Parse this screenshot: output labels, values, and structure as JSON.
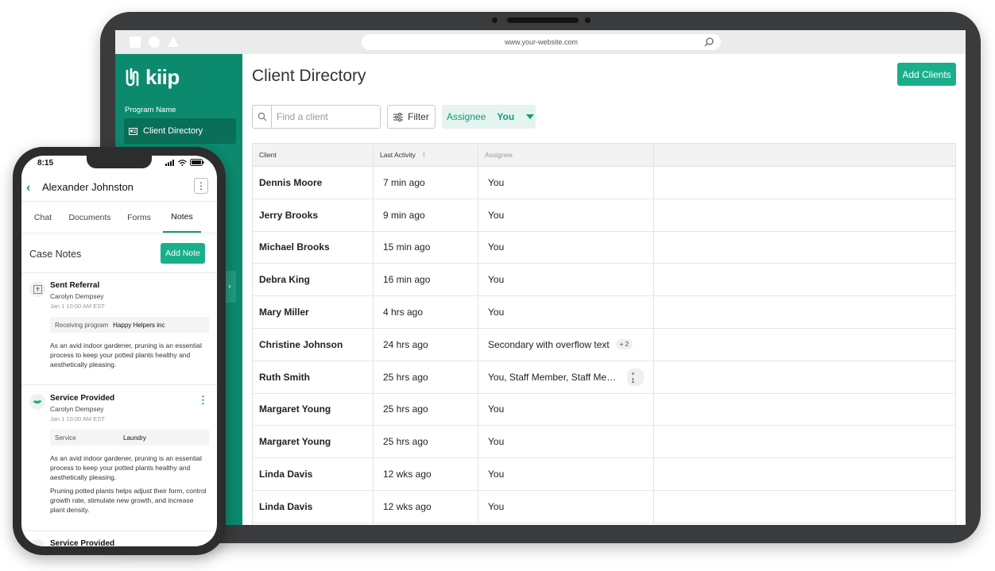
{
  "browser": {
    "url": "www.your-website.com"
  },
  "sidebar": {
    "logo_text": "kiip",
    "program_label": "Program Name",
    "items": [
      {
        "label": "Client Directory"
      }
    ]
  },
  "main": {
    "title": "Client Directory",
    "add_button": "Add Clients",
    "search_placeholder": "Find a client",
    "filter_label": "Filter",
    "assignee_label": "Assignee",
    "assignee_value": "You",
    "columns": {
      "client": "Client",
      "activity": "Last Activity",
      "assignee": "Assignee"
    },
    "rows": [
      {
        "client": "Dennis Moore",
        "activity": "7 min ago",
        "assignee": "You",
        "extra": ""
      },
      {
        "client": "Jerry Brooks",
        "activity": "9 min ago",
        "assignee": "You",
        "extra": ""
      },
      {
        "client": "Michael Brooks",
        "activity": "15 min ago",
        "assignee": "You",
        "extra": ""
      },
      {
        "client": "Debra King",
        "activity": "16 min ago",
        "assignee": "You",
        "extra": ""
      },
      {
        "client": "Mary Miller",
        "activity": "4 hrs ago",
        "assignee": "You",
        "extra": ""
      },
      {
        "client": "Christine Johnson",
        "activity": "24 hrs ago",
        "assignee": "Secondary with overflow text",
        "extra": "+ 2"
      },
      {
        "client": "Ruth Smith",
        "activity": "25 hrs ago",
        "assignee": "You, Staff Member, Staff Member",
        "extra": "+ 1"
      },
      {
        "client": "Margaret Young",
        "activity": "25 hrs ago",
        "assignee": "You",
        "extra": ""
      },
      {
        "client": "Margaret Young",
        "activity": "25 hrs ago",
        "assignee": "You",
        "extra": ""
      },
      {
        "client": "Linda Davis",
        "activity": "12 wks ago",
        "assignee": "You",
        "extra": ""
      },
      {
        "client": "Linda Davis",
        "activity": "12 wks ago",
        "assignee": "You",
        "extra": ""
      }
    ]
  },
  "phone": {
    "time": "8:15",
    "contact_name": "Alexander Johnston",
    "tabs": [
      "Chat",
      "Documents",
      "Forms",
      "Notes"
    ],
    "section_title": "Case Notes",
    "add_note": "Add Note",
    "notes": [
      {
        "icon": "referral-icon",
        "title": "Sent Referral",
        "author": "Carolyn Dempsey",
        "date": "Jan 1 10:00 AM EST",
        "field_label": "Receiving program",
        "field_value": "Happy Helpers inc",
        "body": "As an avid indoor gardener, pruning is an essential process to keep your potted plants healthy and aesthetically pleasing."
      },
      {
        "icon": "service-icon",
        "title": "Service Provided",
        "author": "Carolyn Dempsey",
        "date": "Jan 1 10:00 AM EST",
        "field_label": "Service",
        "field_value": "Laundry",
        "body": "As an avid indoor gardener, pruning is an essential process to keep your potted plants healthy and aesthetically pleasing.",
        "body2": "Pruning potted plants helps adjust their form, control growth rate, stimulate new growth, and increase plant density."
      },
      {
        "icon": "service-icon",
        "title": "Service Provided"
      }
    ]
  },
  "colors": {
    "brand": "#0c8a6e",
    "accent": "#1aaf8b",
    "pill_bg": "#e4f4ef"
  }
}
